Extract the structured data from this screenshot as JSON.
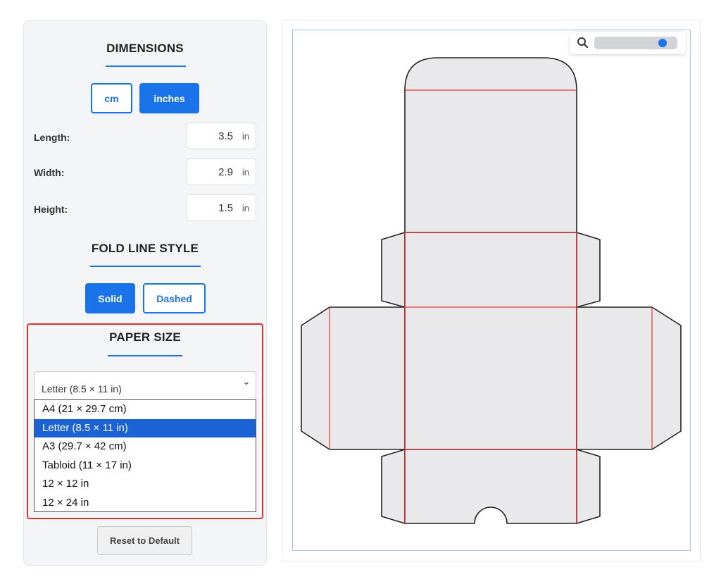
{
  "dimensions": {
    "title": "DIMENSIONS",
    "units": [
      "cm",
      "inches"
    ],
    "selected_unit": "inches",
    "fields": [
      {
        "label": "Length:",
        "value": "3.5",
        "unit": "in"
      },
      {
        "label": "Width:",
        "value": "2.9",
        "unit": "in"
      },
      {
        "label": "Height:",
        "value": "1.5",
        "unit": "in"
      }
    ]
  },
  "fold_line_style": {
    "title": "FOLD LINE STYLE",
    "options": [
      "Solid",
      "Dashed"
    ],
    "selected": "Solid"
  },
  "paper_size": {
    "title": "PAPER SIZE",
    "selected": "Letter (8.5 × 11 in)",
    "options": [
      "A4 (21 × 29.7 cm)",
      "Letter (8.5 × 11 in)",
      "A3 (29.7 × 42 cm)",
      "Tabloid (11 × 17 in)",
      "12 × 12 in",
      "12 × 24 in"
    ],
    "selected_index": 1
  },
  "reset_label": "Reset to Default",
  "zoom": {
    "icon": "search-icon",
    "level": 0.88
  },
  "colors": {
    "accent": "#1a73e8",
    "fold_line": "#e53935",
    "cut_line": "#222222",
    "panel_fill": "#e9e9eb",
    "highlight_border": "#e03131"
  }
}
